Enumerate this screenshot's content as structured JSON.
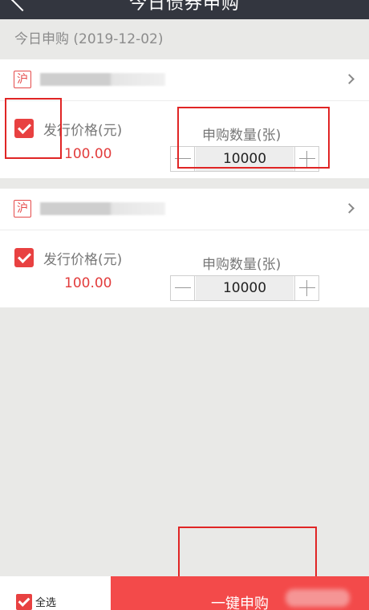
{
  "header": {
    "title": "今日债券申购"
  },
  "subheader": {
    "text": "今日申购  (2019-12-02)"
  },
  "bonds": [
    {
      "market": "沪",
      "price_label": "发行价格(元)",
      "price": "100.00",
      "qty_label": "申购数量(张)",
      "qty": "10000",
      "checked": true
    },
    {
      "market": "沪",
      "price_label": "发行价格(元)",
      "price": "100.00",
      "qty_label": "申购数量(张)",
      "qty": "10000",
      "checked": true
    }
  ],
  "footer": {
    "select_all": "全选",
    "submit": "一键申购"
  },
  "colors": {
    "accent": "#e84141",
    "submit_bg": "#f34a4a",
    "annotation": "#e02525"
  }
}
